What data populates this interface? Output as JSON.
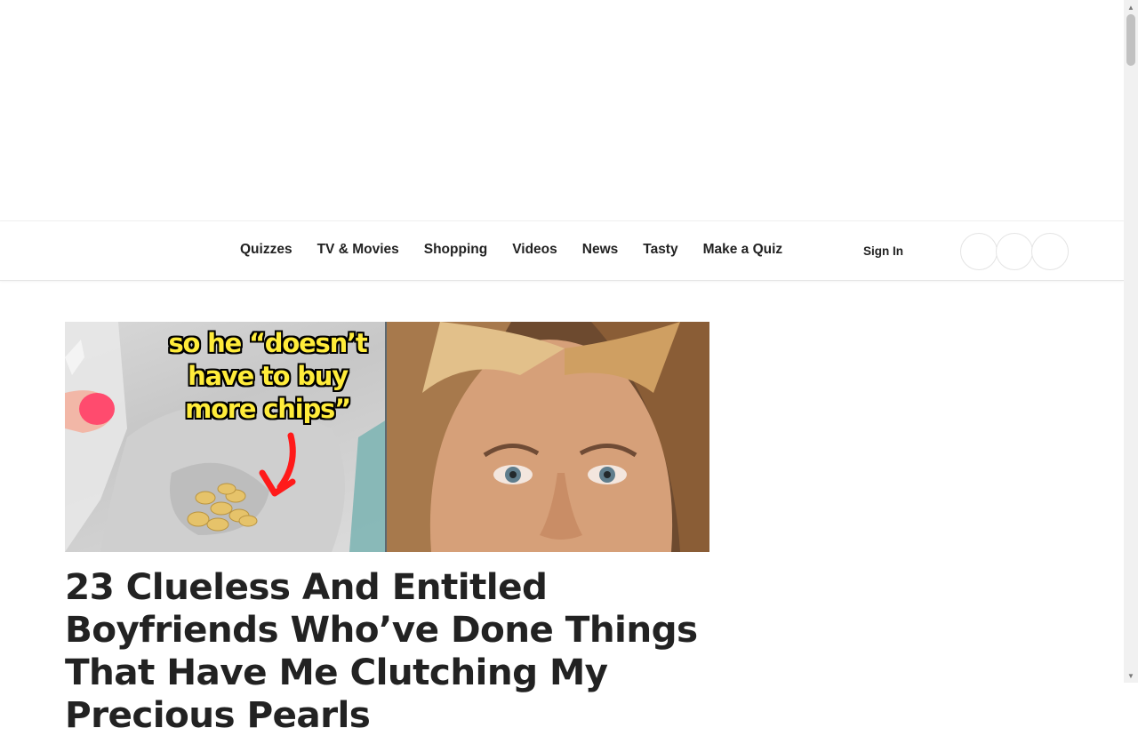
{
  "nav": {
    "items": [
      {
        "label": "Quizzes"
      },
      {
        "label": "TV & Movies"
      },
      {
        "label": "Shopping"
      },
      {
        "label": "Videos"
      },
      {
        "label": "News"
      },
      {
        "label": "Tasty"
      },
      {
        "label": "Make a Quiz"
      }
    ],
    "sign_in": "Sign In"
  },
  "article": {
    "image_caption_lines": [
      "so he “doesn’t",
      "have to buy",
      "more chips”"
    ],
    "title": "23 Clueless And Entitled Boyfriends Who’ve Done Things That Have Me Clutching My Precious Pearls"
  },
  "colors": {
    "caption_text": "#ffec3a",
    "arrow": "#ff1a1a",
    "nail_polish": "#ff4b6e"
  },
  "icons": {
    "scroll_up": "triangle-up-icon",
    "scroll_down": "triangle-down-icon"
  }
}
